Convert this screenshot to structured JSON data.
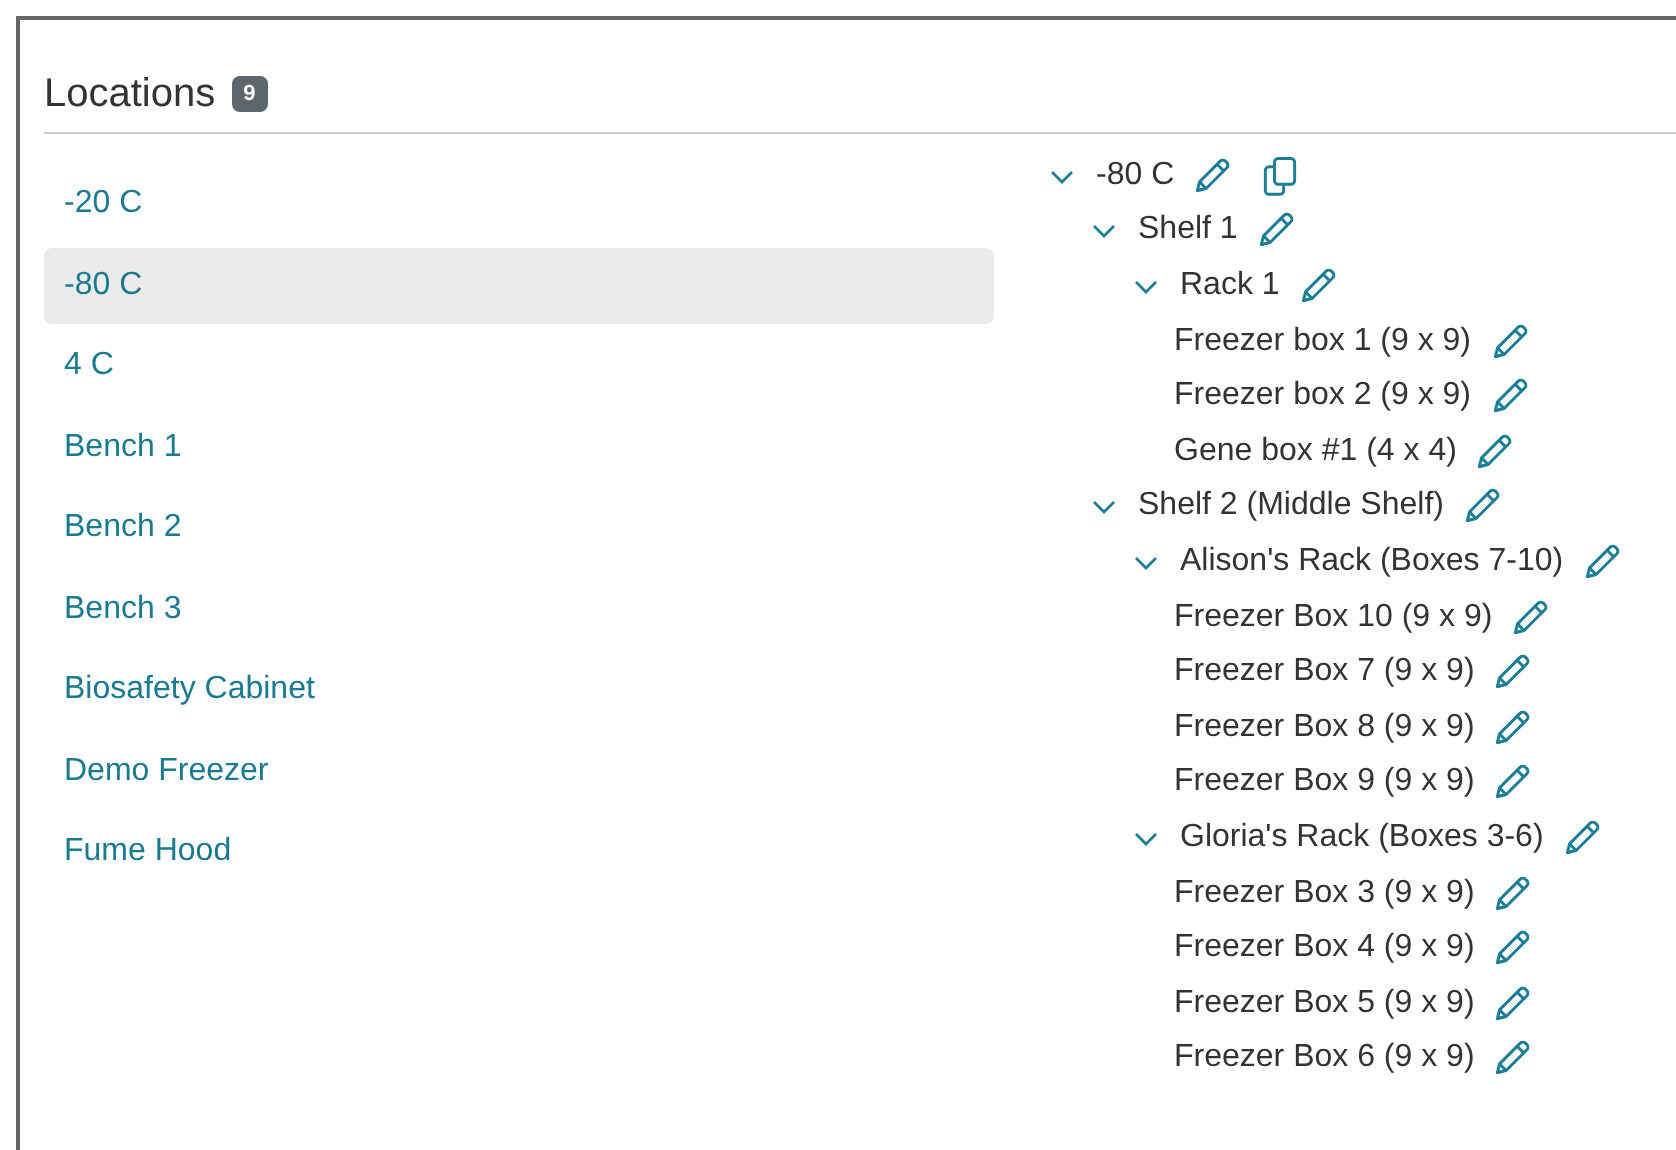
{
  "header": {
    "title": "Locations",
    "count": "9"
  },
  "locations": [
    {
      "label": "-20 C",
      "selected": false
    },
    {
      "label": "-80 C",
      "selected": true
    },
    {
      "label": "4 C",
      "selected": false
    },
    {
      "label": "Bench 1",
      "selected": false
    },
    {
      "label": "Bench 2",
      "selected": false
    },
    {
      "label": "Bench 3",
      "selected": false
    },
    {
      "label": "Biosafety Cabinet",
      "selected": false
    },
    {
      "label": "Demo Freezer",
      "selected": false
    },
    {
      "label": "Fume Hood",
      "selected": false
    }
  ],
  "tree": [
    {
      "label": "-80 C",
      "expanded": true,
      "copyable": true,
      "children": [
        {
          "label": "Shelf 1",
          "expanded": true,
          "children": [
            {
              "label": "Rack 1",
              "expanded": true,
              "children": [
                {
                  "label": "Freezer box 1 (9 x 9)"
                },
                {
                  "label": "Freezer box 2 (9 x 9)"
                },
                {
                  "label": "Gene box #1 (4 x 4)"
                }
              ]
            }
          ]
        },
        {
          "label": "Shelf 2 (Middle Shelf)",
          "expanded": true,
          "children": [
            {
              "label": "Alison's Rack (Boxes 7-10)",
              "expanded": true,
              "children": [
                {
                  "label": "Freezer Box 10 (9 x 9)"
                },
                {
                  "label": "Freezer Box 7 (9 x 9)"
                },
                {
                  "label": "Freezer Box 8 (9 x 9)"
                },
                {
                  "label": "Freezer Box 9 (9 x 9)"
                }
              ]
            },
            {
              "label": "Gloria's Rack (Boxes 3-6)",
              "expanded": true,
              "children": [
                {
                  "label": "Freezer Box 3 (9 x 9)"
                },
                {
                  "label": "Freezer Box 4 (9 x 9)"
                },
                {
                  "label": "Freezer Box 5 (9 x 9)"
                },
                {
                  "label": "Freezer Box 6 (9 x 9)"
                }
              ]
            }
          ]
        }
      ]
    }
  ]
}
